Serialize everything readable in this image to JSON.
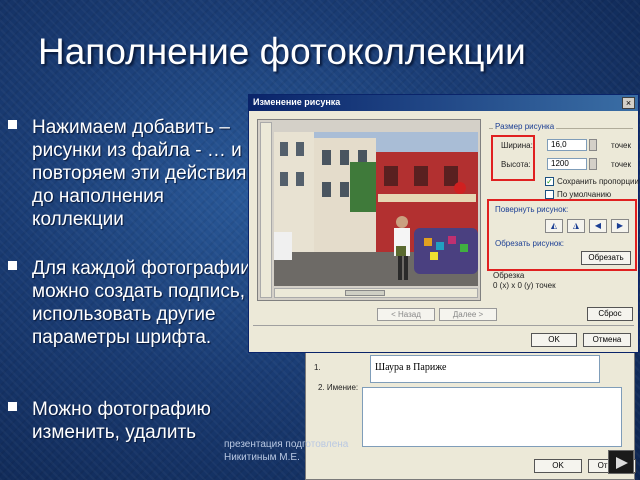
{
  "slide": {
    "title": "Наполнение фотоколлекции",
    "bullets": [
      "Нажимаем добавить – рисунки из файла - … и повторяем эти действия до наполнения коллекции",
      "Для каждой фотографии можно создать подпись, использовать другие параметры шрифта.",
      "Можно фотографию изменить, удалить"
    ],
    "credit": "презентация подготовлена Никитиным М.Е."
  },
  "back_dialog": {
    "caption_value": "Шаура в Париже",
    "caption_number": "1.",
    "label_2": "2. Имение:",
    "ok_label": "OK",
    "cancel_label": "Отмена"
  },
  "dialog": {
    "title": "Изменение рисунка",
    "close_label": "×",
    "size_group": "Размер рисунка",
    "width_label": "Ширина:",
    "width_value": "16,0",
    "height_label": "Высота:",
    "height_value": "1200",
    "unit_1": "точек",
    "unit_2": "точек",
    "keep_proportions": "Сохранить пропорции",
    "default_label": "По умолчанию",
    "rotate_group": "Повернуть рисунок:",
    "rotate_buttons": [
      "◭",
      "◮",
      "◀",
      "▶"
    ],
    "flip_group": "Обрезать рисунок:",
    "crop_button": "Обрезать",
    "crop_group": "Обрезка",
    "crop_value": "0 (х) х 0 (у) точек",
    "reset_button": "Сброс",
    "prev_button": "< Назад",
    "next_button": "Далее >",
    "ok_button": "OK",
    "cancel_button": "Отмена"
  },
  "colors": {
    "highlight": "#e02020",
    "titlebar": "#0a246a"
  }
}
